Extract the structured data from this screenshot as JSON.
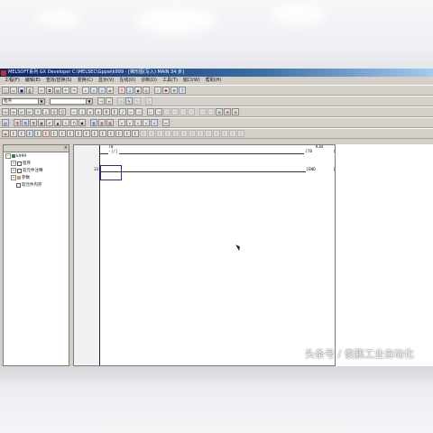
{
  "window": {
    "title": "MELSOFT系列 GX Developer C:\\MELSEC\\Gppw\\k999 - [梯形图(写入)    MAIN    34 步]"
  },
  "menu": [
    "工程(F)",
    "编辑(E)",
    "查找/替换(S)",
    "变换(C)",
    "显示(V)",
    "在线(O)",
    "诊断(D)",
    "工具(T)",
    "窗口(W)",
    "帮助(H)"
  ],
  "toolbar": {
    "program_combo": "程序",
    "combo2": ""
  },
  "project_tree": {
    "root": "k999",
    "items": [
      "程序",
      "软元件注释",
      "参数",
      "软元件内存"
    ],
    "expanders": [
      "+",
      "+",
      "+",
      "-"
    ]
  },
  "ladder": {
    "rung1": {
      "contact": "T0",
      "coil_label": "K10",
      "coil": "(T0",
      "step_top": ""
    },
    "rung2": {
      "step": "33",
      "end": "[END"
    },
    "right_paren": ")",
    "right_bracket": "]"
  },
  "watermark": "头条号 / 俊鹏工业自动化",
  "colors": {
    "titlebar": "#0a246a",
    "cursor": "#1c2f9c",
    "window_bg": "#d4d0c8"
  }
}
